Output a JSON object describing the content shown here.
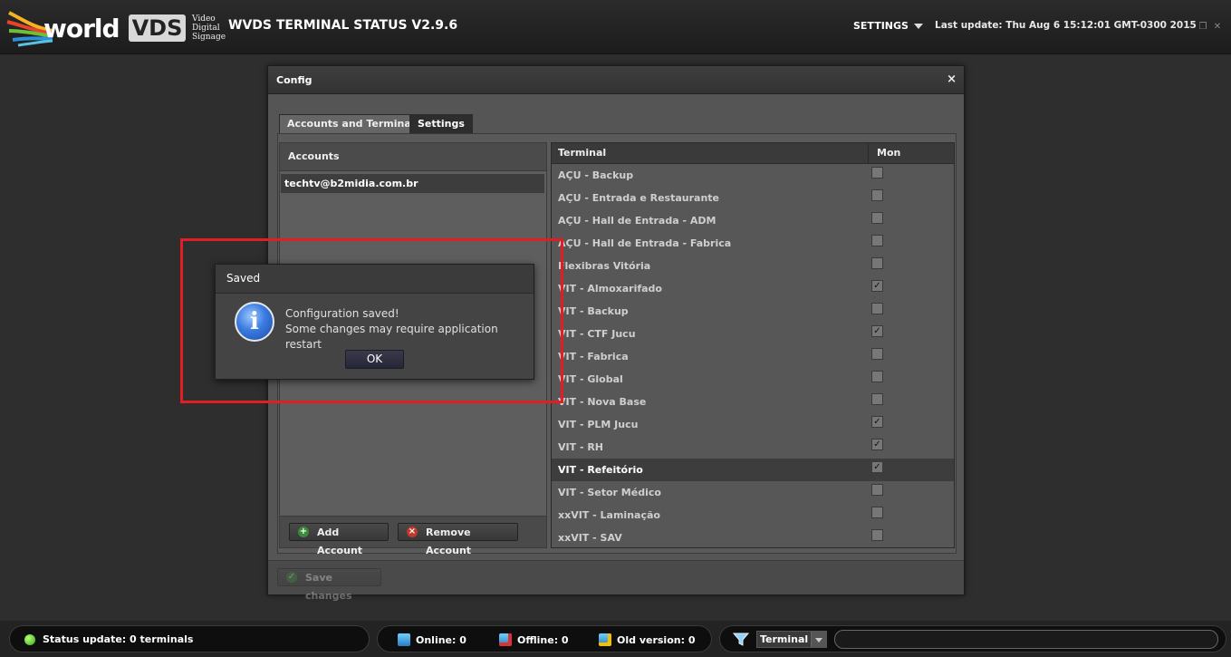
{
  "app": {
    "logo_world": "world",
    "logo_vds": "VDS",
    "logo_sub": "Video\nDigital\nSignage",
    "title": "WVDS TERMINAL STATUS V2.9.6",
    "settings_label": "SETTINGS",
    "last_update": "Last update: Thu Aug 6 15:12:01 GMT-0300 2015"
  },
  "config": {
    "title": "Config",
    "close_symbol": "×",
    "tabs": [
      {
        "label": "Accounts and Terminals",
        "active": false
      },
      {
        "label": "Settings",
        "active": true
      }
    ],
    "accounts": {
      "header": "Accounts",
      "items": [
        "techtv@b2midia.com.br"
      ],
      "add_label": "Add Account",
      "remove_label": "Remove Account"
    },
    "terminals": {
      "col_terminal": "Terminal",
      "col_mon": "Mon",
      "rows": [
        {
          "name": "AÇU - Backup",
          "mon": false
        },
        {
          "name": "AÇU - Entrada e Restaurante",
          "mon": false
        },
        {
          "name": "AÇU - Hall de Entrada - ADM",
          "mon": false
        },
        {
          "name": "AÇU - Hall de Entrada - Fabrica",
          "mon": false
        },
        {
          "name": "Flexibras Vitória",
          "mon": false
        },
        {
          "name": "VIT - Almoxarifado",
          "mon": true
        },
        {
          "name": "VIT - Backup",
          "mon": false
        },
        {
          "name": "VIT - CTF Jucu",
          "mon": true
        },
        {
          "name": "VIT - Fabrica",
          "mon": false
        },
        {
          "name": "VIT - Global",
          "mon": false
        },
        {
          "name": "VIT - Nova Base",
          "mon": false
        },
        {
          "name": "VIT - PLM Jucu",
          "mon": true
        },
        {
          "name": "VIT - RH",
          "mon": true
        },
        {
          "name": "VIT - Refeitório",
          "mon": true,
          "selected": true
        },
        {
          "name": "VIT - Setor Médico",
          "mon": false
        },
        {
          "name": "xxVIT - Laminação",
          "mon": false
        },
        {
          "name": "xxVIT - SAV",
          "mon": false
        }
      ]
    },
    "save_label": "Save changes"
  },
  "dialog": {
    "title": "Saved",
    "line1": "Configuration saved!",
    "line2": "Some changes may require application restart",
    "ok_label": "OK",
    "icon": "info-icon"
  },
  "statusbar": {
    "status_text": "Status update: 0 terminals",
    "online": "Online: 0",
    "offline": "Offline: 0",
    "old_version": "Old version: 0",
    "filter_select": "Terminal",
    "search_value": ""
  },
  "colors": {
    "background": "#2e2e2e",
    "highlight_box": "#e21d24",
    "status_dot": "#35a912"
  }
}
